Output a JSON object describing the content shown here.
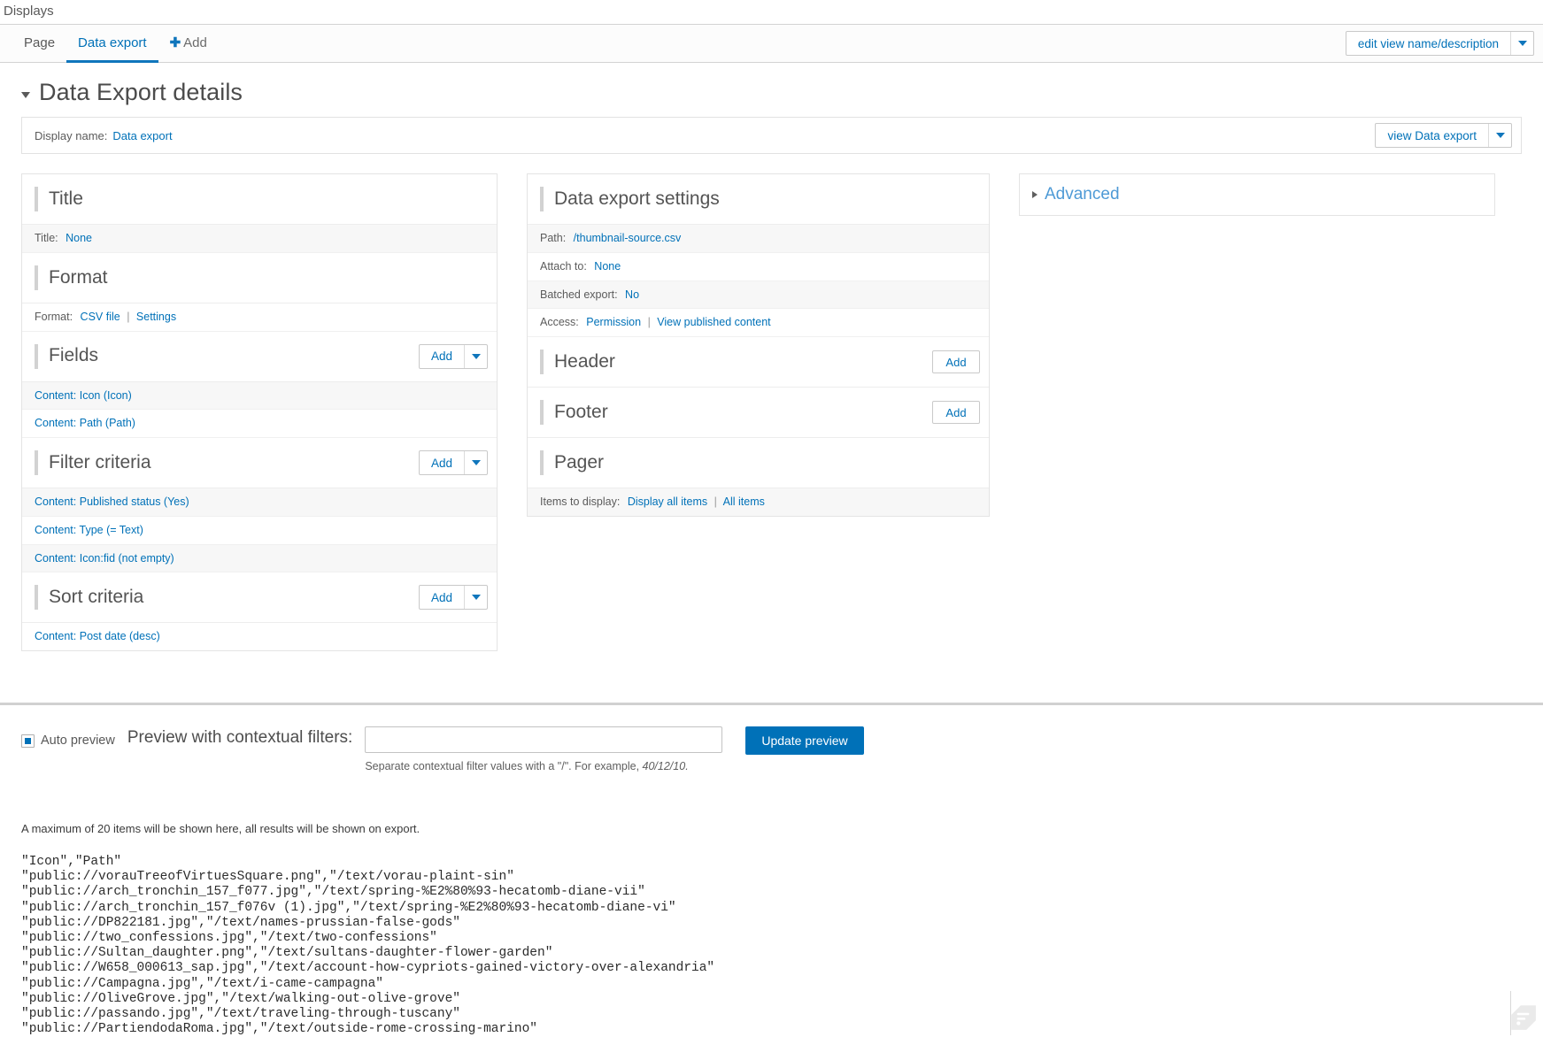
{
  "breadcrumb": {
    "label": "Displays"
  },
  "tabs": [
    {
      "id": "page",
      "label": "Page",
      "active": false
    },
    {
      "id": "data-export",
      "label": "Data export",
      "active": true
    },
    {
      "id": "add",
      "label": "Add",
      "active": false,
      "icon": "plus-icon"
    }
  ],
  "toolbar": {
    "edit_view_button": "edit view name/description",
    "dropdown_icon": "chevron-down-icon"
  },
  "details": {
    "title": "Data Export details",
    "collapse_icon": "triangle-down-icon"
  },
  "display_name": {
    "label": "Display name:",
    "value": "Data export",
    "view_button": "view Data export"
  },
  "buckets": {
    "title": {
      "heading": "Title",
      "rows": [
        {
          "label": "Title:",
          "links": [
            "None"
          ]
        }
      ]
    },
    "format": {
      "heading": "Format",
      "rows": [
        {
          "label": "Format:",
          "links": [
            "CSV file",
            "Settings"
          ]
        }
      ]
    },
    "fields": {
      "heading": "Fields",
      "add_label": "Add",
      "items": [
        "Content: Icon (Icon)",
        "Content: Path (Path)"
      ]
    },
    "filter_criteria": {
      "heading": "Filter criteria",
      "add_label": "Add",
      "items": [
        "Content: Published status (Yes)",
        "Content: Type (= Text)",
        "Content: Icon:fid (not empty)"
      ]
    },
    "sort_criteria": {
      "heading": "Sort criteria",
      "add_label": "Add",
      "items": [
        "Content: Post date (desc)"
      ]
    },
    "data_export_settings": {
      "heading": "Data export settings",
      "rows": [
        {
          "label": "Path:",
          "links": [
            "/thumbnail-source.csv"
          ]
        },
        {
          "label": "Attach to:",
          "links": [
            "None"
          ]
        },
        {
          "label": "Batched export:",
          "links": [
            "No"
          ]
        },
        {
          "label": "Access:",
          "links": [
            "Permission",
            "View published content"
          ]
        }
      ]
    },
    "header": {
      "heading": "Header",
      "add_label": "Add"
    },
    "footer": {
      "heading": "Footer",
      "add_label": "Add"
    },
    "pager": {
      "heading": "Pager",
      "rows": [
        {
          "label": "Items to display:",
          "links": [
            "Display all items",
            "All items"
          ]
        }
      ]
    },
    "advanced": {
      "heading": "Advanced",
      "expand_icon": "triangle-right-icon"
    }
  },
  "preview": {
    "auto_preview_label": "Auto preview",
    "auto_preview_checked": true,
    "contextual_label": "Preview with contextual filters:",
    "contextual_value": "",
    "contextual_placeholder": "",
    "help_prefix": "Separate contextual filter values with a \"/\". For example, ",
    "help_example": "40/12/10.",
    "update_button": "Update preview",
    "max_items_note": "A maximum of 20 items will be shown here, all results will be shown on export.",
    "csv_output": "\"Icon\",\"Path\"\n\"public://vorauTreeofVirtuesSquare.png\",\"/text/vorau-plaint-sin\"\n\"public://arch_tronchin_157_f077.jpg\",\"/text/spring-%E2%80%93-hecatomb-diane-vii\"\n\"public://arch_tronchin_157_f076v (1).jpg\",\"/text/spring-%E2%80%93-hecatomb-diane-vi\"\n\"public://DP822181.jpg\",\"/text/names-prussian-false-gods\"\n\"public://two_confessions.jpg\",\"/text/two-confessions\"\n\"public://Sultan_daughter.png\",\"/text/sultans-daughter-flower-garden\"\n\"public://W658_000613_sap.jpg\",\"/text/account-how-cypriots-gained-victory-over-alexandria\"\n\"public://Campagna.jpg\",\"/text/i-came-campagna\"\n\"public://OliveGrove.jpg\",\"/text/walking-out-olive-grove\"\n\"public://passando.jpg\",\"/text/traveling-through-tuscany\"\n\"public://PartiendodaRoma.jpg\",\"/text/outside-rome-crossing-marino\""
  },
  "colors": {
    "link": "#0071b8",
    "primary_button": "#0071b8",
    "active_tab_underline": "#1076bc",
    "accent_bar": "#d2d2d2"
  }
}
